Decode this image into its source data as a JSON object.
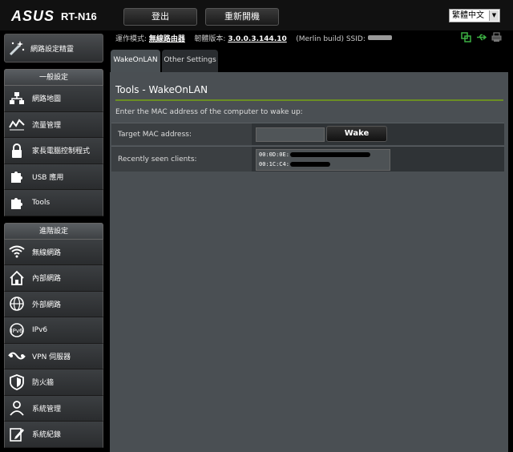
{
  "header": {
    "brand": "ASUS",
    "model": "RT-N16",
    "logout_label": "登出",
    "reboot_label": "重新開機",
    "language": "繁體中文"
  },
  "status": {
    "mode_label": "運作模式:",
    "mode_value": "無線路由器",
    "firmware_label": "韌體版本:",
    "firmware_value": "3.0.0.3.144.10",
    "build": "(Merlin build)",
    "ssid_label": "SSID:"
  },
  "sidebar": {
    "qis_label": "網路設定精靈",
    "general_header": "一般設定",
    "general_items": [
      {
        "label": "網路地圖",
        "icon": "network-map-icon"
      },
      {
        "label": "流量管理",
        "icon": "traffic-icon"
      },
      {
        "label": "家長電腦控制程式",
        "icon": "lock-icon"
      },
      {
        "label": "USB 應用",
        "icon": "puzzle-icon"
      },
      {
        "label": "Tools",
        "icon": "tools-icon"
      }
    ],
    "advanced_header": "進階設定",
    "advanced_items": [
      {
        "label": "無線網路",
        "icon": "wifi-icon"
      },
      {
        "label": "內部網路",
        "icon": "home-icon"
      },
      {
        "label": "外部網路",
        "icon": "globe-icon"
      },
      {
        "label": "IPv6",
        "icon": "ipv6-icon"
      },
      {
        "label": "VPN 伺服器",
        "icon": "vpn-icon"
      },
      {
        "label": "防火牆",
        "icon": "shield-icon"
      },
      {
        "label": "系統管理",
        "icon": "admin-icon"
      },
      {
        "label": "系統紀錄",
        "icon": "log-icon"
      }
    ]
  },
  "tabs": [
    {
      "label": "WakeOnLAN",
      "active": true
    },
    {
      "label": "Other Settings",
      "active": false
    }
  ],
  "main": {
    "title": "Tools - WakeOnLAN",
    "description": "Enter the MAC address of the computer to wake up:",
    "target_label": "Target MAC address:",
    "wake_label": "Wake",
    "recent_label": "Recently seen clients:",
    "clients": [
      "00:0D:0E:",
      "00:1C:C4:"
    ]
  },
  "colors": {
    "accent_line": "#6b8e23",
    "panel_bg": "#4a4f53",
    "status_icon": "#3cb043"
  }
}
